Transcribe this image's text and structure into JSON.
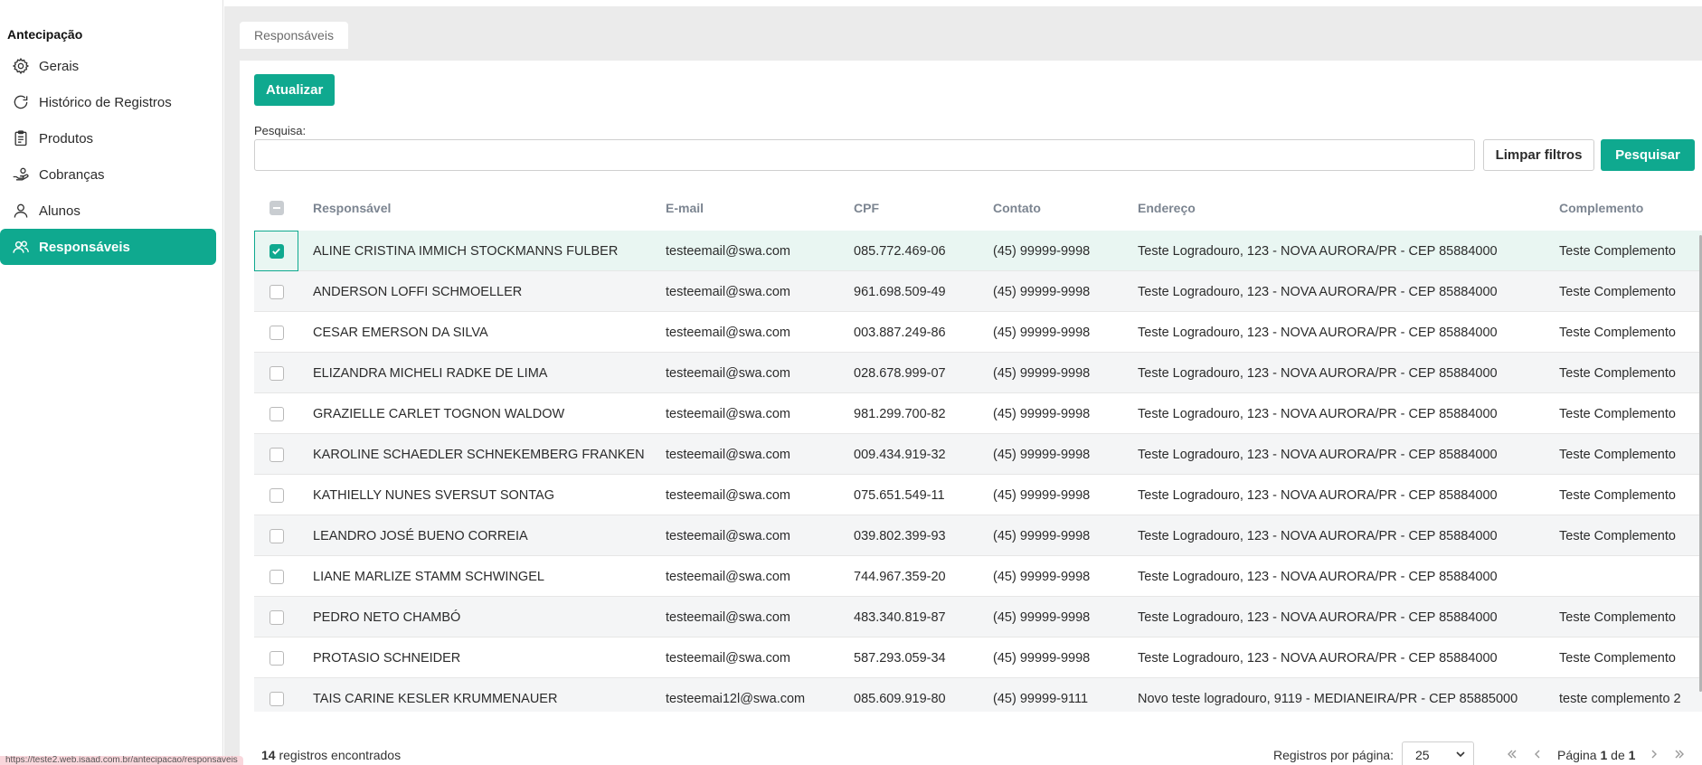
{
  "sidebar": {
    "title": "Antecipação",
    "items": [
      {
        "label": "Gerais",
        "icon": "gear-icon"
      },
      {
        "label": "Histórico de Registros",
        "icon": "refresh-icon"
      },
      {
        "label": "Produtos",
        "icon": "clipboard-icon"
      },
      {
        "label": "Cobranças",
        "icon": "hand-coin-icon"
      },
      {
        "label": "Alunos",
        "icon": "user-icon"
      },
      {
        "label": "Responsáveis",
        "icon": "users-icon",
        "active": true
      }
    ]
  },
  "tab": {
    "label": "Responsáveis"
  },
  "toolbar": {
    "update_label": "Atualizar"
  },
  "search": {
    "label": "Pesquisa:",
    "value": "",
    "placeholder": "",
    "clear_label": "Limpar filtros",
    "search_label": "Pesquisar"
  },
  "table": {
    "columns": [
      "Responsável",
      "E-mail",
      "CPF",
      "Contato",
      "Endereço",
      "Complemento"
    ],
    "rows": [
      {
        "name": "ALINE CRISTINA IMMICH STOCKMANNS FULBER",
        "email": "testeemail@swa.com",
        "cpf": "085.772.469-06",
        "contato": "(45) 99999-9998",
        "endereco": "Teste Logradouro, 123 - NOVA AURORA/PR - CEP 85884000",
        "complemento": "Teste Complemento",
        "checked": true
      },
      {
        "name": "ANDERSON LOFFI SCHMOELLER",
        "email": "testeemail@swa.com",
        "cpf": "961.698.509-49",
        "contato": "(45) 99999-9998",
        "endereco": "Teste Logradouro, 123 - NOVA AURORA/PR - CEP 85884000",
        "complemento": "Teste Complemento",
        "checked": false
      },
      {
        "name": "CESAR EMERSON DA SILVA",
        "email": "testeemail@swa.com",
        "cpf": "003.887.249-86",
        "contato": "(45) 99999-9998",
        "endereco": "Teste Logradouro, 123 - NOVA AURORA/PR - CEP 85884000",
        "complemento": "Teste Complemento",
        "checked": false
      },
      {
        "name": "ELIZANDRA MICHELI RADKE DE LIMA",
        "email": "testeemail@swa.com",
        "cpf": "028.678.999-07",
        "contato": "(45) 99999-9998",
        "endereco": "Teste Logradouro, 123 - NOVA AURORA/PR - CEP 85884000",
        "complemento": "Teste Complemento",
        "checked": false
      },
      {
        "name": "GRAZIELLE CARLET TOGNON WALDOW",
        "email": "testeemail@swa.com",
        "cpf": "981.299.700-82",
        "contato": "(45) 99999-9998",
        "endereco": "Teste Logradouro, 123 - NOVA AURORA/PR - CEP 85884000",
        "complemento": "Teste Complemento",
        "checked": false
      },
      {
        "name": "KAROLINE SCHAEDLER SCHNEKEMBERG FRANKEN",
        "email": "testeemail@swa.com",
        "cpf": "009.434.919-32",
        "contato": "(45) 99999-9998",
        "endereco": "Teste Logradouro, 123 - NOVA AURORA/PR - CEP 85884000",
        "complemento": "Teste Complemento",
        "checked": false
      },
      {
        "name": "KATHIELLY NUNES SVERSUT SONTAG",
        "email": "testeemail@swa.com",
        "cpf": "075.651.549-11",
        "contato": "(45) 99999-9998",
        "endereco": "Teste Logradouro, 123 - NOVA AURORA/PR - CEP 85884000",
        "complemento": "Teste Complemento",
        "checked": false
      },
      {
        "name": "LEANDRO JOSÉ BUENO CORREIA",
        "email": "testeemail@swa.com",
        "cpf": "039.802.399-93",
        "contato": "(45) 99999-9998",
        "endereco": "Teste Logradouro, 123 - NOVA AURORA/PR - CEP 85884000",
        "complemento": "Teste Complemento",
        "checked": false
      },
      {
        "name": "LIANE MARLIZE STAMM SCHWINGEL",
        "email": "testeemail@swa.com",
        "cpf": "744.967.359-20",
        "contato": "(45) 99999-9998",
        "endereco": "Teste Logradouro, 123 - NOVA AURORA/PR - CEP 85884000",
        "complemento": "",
        "checked": false
      },
      {
        "name": "PEDRO NETO CHAMBÓ",
        "email": "testeemail@swa.com",
        "cpf": "483.340.819-87",
        "contato": "(45) 99999-9998",
        "endereco": "Teste Logradouro, 123 - NOVA AURORA/PR - CEP 85884000",
        "complemento": "Teste Complemento",
        "checked": false
      },
      {
        "name": "PROTASIO SCHNEIDER",
        "email": "testeemail@swa.com",
        "cpf": "587.293.059-34",
        "contato": "(45) 99999-9998",
        "endereco": "Teste Logradouro, 123 - NOVA AURORA/PR - CEP 85884000",
        "complemento": "Teste Complemento",
        "checked": false
      },
      {
        "name": "TAIS CARINE KESLER KRUMMENAUER",
        "email": "testeemai12l@swa.com",
        "cpf": "085.609.919-80",
        "contato": "(45) 99999-9111",
        "endereco": "Novo teste logradouro, 9119 - MEDIANEIRA/PR - CEP 85885000",
        "complemento": "teste complemento 2",
        "checked": false
      }
    ]
  },
  "footer": {
    "count": "14",
    "count_suffix": " registros encontrados",
    "per_page_label": "Registros por página:",
    "per_page_value": "25",
    "page_prefix": "Página ",
    "page_current": "1",
    "page_of": " de ",
    "page_total": "1"
  },
  "status_bar": {
    "url": "https://teste2.web.isaad.com.br/antecipacao/responsaveis"
  },
  "colors": {
    "accent": "#0fa98f"
  }
}
